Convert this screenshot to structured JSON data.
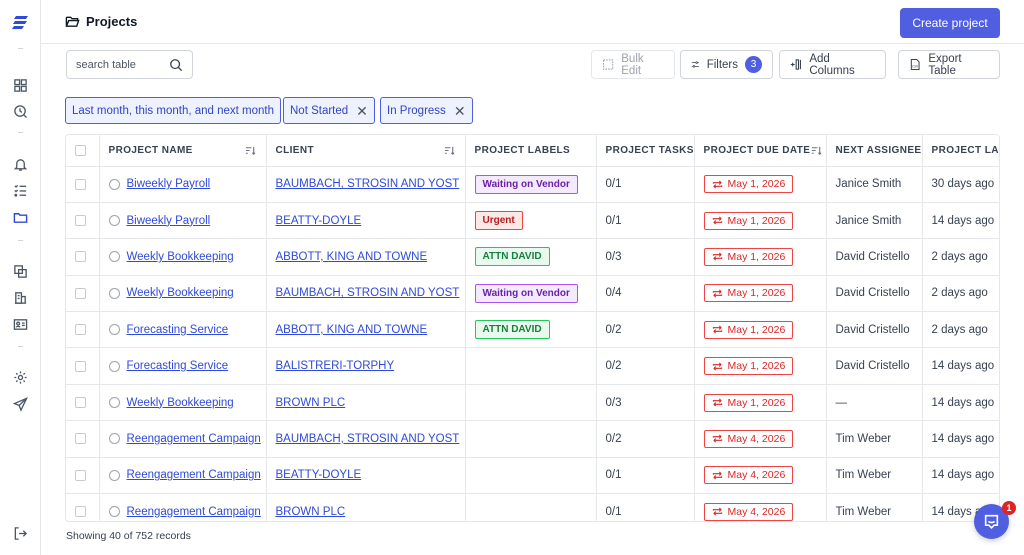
{
  "header": {
    "title": "Projects",
    "create_label": "Create project"
  },
  "toolbar": {
    "search_placeholder": "search table",
    "bulk_edit": "Bulk Edit",
    "filters": "Filters",
    "filters_count": "3",
    "add_columns": "Add Columns",
    "export": "Export Table"
  },
  "filters": [
    "Last month, this month, and next month",
    "Not Started",
    "In Progress"
  ],
  "table": {
    "columns": [
      "PROJECT NAME",
      "CLIENT",
      "PROJECT LABELS",
      "PROJECT TASKS",
      "PROJECT DUE DATE",
      "NEXT ASSIGNEE",
      "PROJECT LAST"
    ],
    "rows": [
      {
        "name": "Biweekly Payroll",
        "client": "BAUMBACH, STROSIN AND YOST",
        "label": "Waiting on Vendor",
        "label_type": "vendor",
        "tasks": "0/1",
        "due": "May 1, 2026",
        "assignee": "Janice Smith",
        "last": "30 days ago"
      },
      {
        "name": "Biweekly Payroll",
        "client": "BEATTY-DOYLE",
        "label": "Urgent",
        "label_type": "urgent",
        "tasks": "0/1",
        "due": "May 1, 2026",
        "assignee": "Janice Smith",
        "last": "14 days ago"
      },
      {
        "name": "Weekly Bookkeeping",
        "client": "ABBOTT, KING AND TOWNE",
        "label": "ATTN DAVID",
        "label_type": "attn",
        "tasks": "0/3",
        "due": "May 1, 2026",
        "assignee": "David Cristello",
        "last": "2 days ago"
      },
      {
        "name": "Weekly Bookkeeping",
        "client": "BAUMBACH, STROSIN AND YOST",
        "label": "Waiting on Vendor",
        "label_type": "vendor",
        "tasks": "0/4",
        "due": "May 1, 2026",
        "assignee": "David Cristello",
        "last": "2 days ago"
      },
      {
        "name": "Forecasting Service",
        "client": "ABBOTT, KING AND TOWNE",
        "label": "ATTN DAVID",
        "label_type": "attn",
        "tasks": "0/2",
        "due": "May 1, 2026",
        "assignee": "David Cristello",
        "last": "2 days ago"
      },
      {
        "name": "Forecasting Service",
        "client": "BALISTRERI-TORPHY",
        "label": "",
        "label_type": "",
        "tasks": "0/2",
        "due": "May 1, 2026",
        "assignee": "David Cristello",
        "last": "14 days ago"
      },
      {
        "name": "Weekly Bookkeeping",
        "client": "BROWN PLC",
        "label": "",
        "label_type": "",
        "tasks": "0/3",
        "due": "May 1, 2026",
        "assignee": "—",
        "last": "14 days ago"
      },
      {
        "name": "Reengagement Campaign",
        "client": "BAUMBACH, STROSIN AND YOST",
        "label": "",
        "label_type": "",
        "tasks": "0/2",
        "due": "May 4, 2026",
        "assignee": "Tim Weber",
        "last": "14 days ago"
      },
      {
        "name": "Reengagement Campaign",
        "client": "BEATTY-DOYLE",
        "label": "",
        "label_type": "",
        "tasks": "0/1",
        "due": "May 4, 2026",
        "assignee": "Tim Weber",
        "last": "14 days ago"
      },
      {
        "name": "Reengagement Campaign",
        "client": "BROWN PLC",
        "label": "",
        "label_type": "",
        "tasks": "0/1",
        "due": "May 4, 2026",
        "assignee": "Tim Weber",
        "last": "14 days ago"
      }
    ]
  },
  "footer": {
    "showing": "Showing 40 of 752 records"
  },
  "chat": {
    "badge": "1"
  },
  "colors": {
    "accent": "#4f5fe0",
    "link": "#2f4ad8",
    "due_red": "#dc2626"
  }
}
